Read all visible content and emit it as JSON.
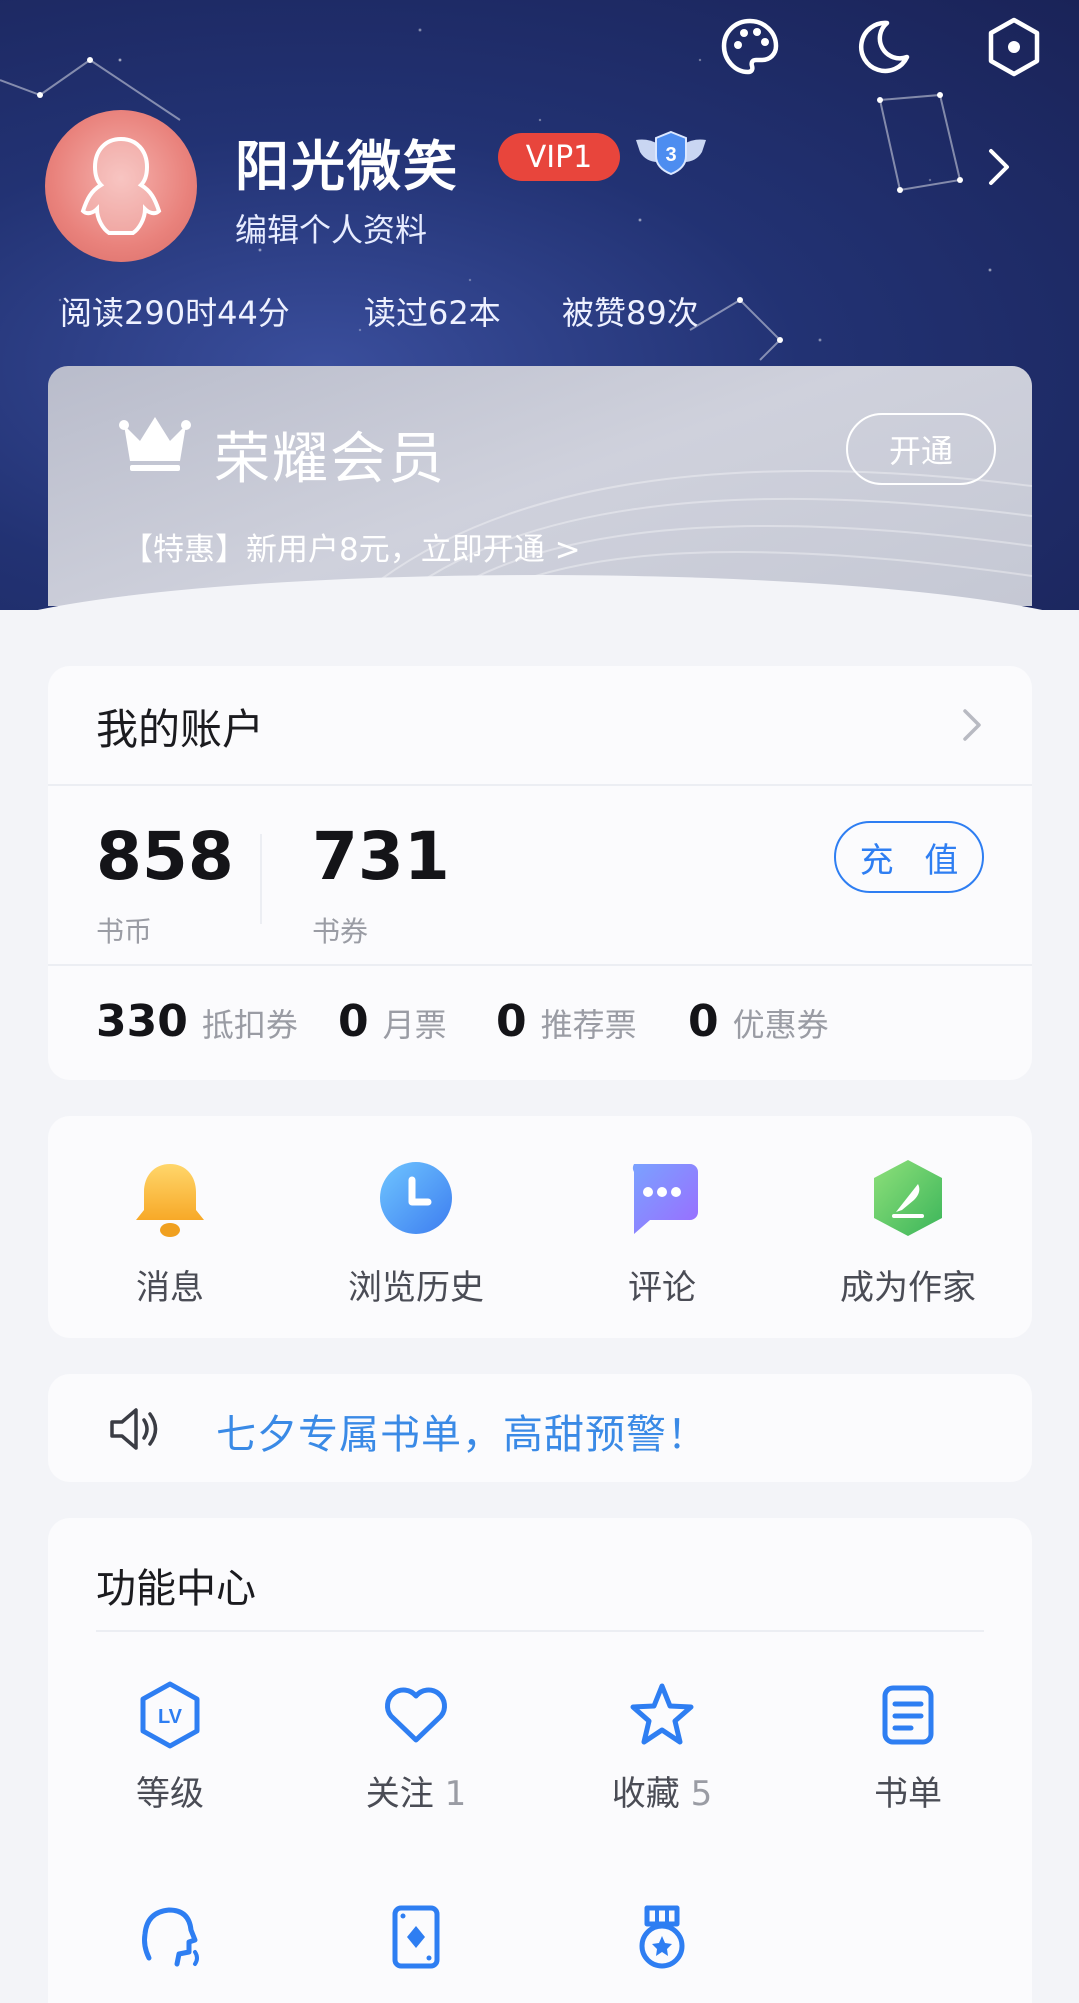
{
  "header": {
    "username": "阳光微笑",
    "vip_label": "VIP1",
    "level_badge": "3",
    "edit_profile": "编辑个人资料",
    "stats": [
      "阅读290时44分",
      "读过62本",
      "被赞89次"
    ]
  },
  "top_icons": [
    "palette-icon",
    "moon-icon",
    "settings-hexagon-icon"
  ],
  "member": {
    "title": "荣耀会员",
    "open_label": "开通",
    "promo": "【特惠】新用户8元，立即开通 >"
  },
  "account": {
    "title": "我的账户",
    "coins_value": "858",
    "coins_label": "书币",
    "vouchers_value": "731",
    "vouchers_label": "书券",
    "recharge_label": "充 值",
    "tickets": [
      {
        "value": "330",
        "label": "抵扣券"
      },
      {
        "value": "0",
        "label": "月票"
      },
      {
        "value": "0",
        "label": "推荐票"
      },
      {
        "value": "0",
        "label": "优惠券"
      }
    ]
  },
  "quick": [
    {
      "label": "消息",
      "icon": "bell-icon"
    },
    {
      "label": "浏览历史",
      "icon": "clock-icon"
    },
    {
      "label": "评论",
      "icon": "chat-bubble-icon"
    },
    {
      "label": "成为作家",
      "icon": "pen-hexagon-icon"
    }
  ],
  "notice": {
    "text": "七夕专属书单，高甜预警！"
  },
  "functions": {
    "title": "功能中心",
    "items": [
      {
        "label": "等级",
        "count": "",
        "icon": "level-icon"
      },
      {
        "label": "关注",
        "count": "1",
        "icon": "heart-icon"
      },
      {
        "label": "收藏",
        "count": "5",
        "icon": "star-icon"
      },
      {
        "label": "书单",
        "count": "",
        "icon": "booklist-icon"
      },
      {
        "label": "",
        "count": "",
        "icon": "voice-head-icon"
      },
      {
        "label": "",
        "count": "",
        "icon": "card-icon"
      },
      {
        "label": "",
        "count": "",
        "icon": "medal-icon"
      }
    ]
  },
  "colors": {
    "accent_blue": "#2e7ef2",
    "vip_red": "#e8453c",
    "header_navy": "#223273",
    "notice_blue": "#3a8ae6"
  }
}
